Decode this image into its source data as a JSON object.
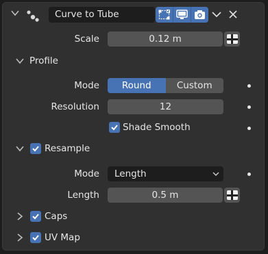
{
  "header": {
    "modifier_name": "Curve to Tube",
    "icons": [
      "modifier-node-icon",
      "edit-mode-toggle-icon",
      "viewport-display-icon",
      "render-camera-icon",
      "dropdown-chevron-icon",
      "close-icon"
    ]
  },
  "scale": {
    "label": "Scale",
    "value": "0.12 m"
  },
  "profile": {
    "title": "Profile",
    "expanded": true,
    "mode_label": "Mode",
    "mode_options": [
      "Round",
      "Custom"
    ],
    "mode_selected": "Round",
    "resolution_label": "Resolution",
    "resolution_value": "12",
    "shade_smooth_label": "Shade Smooth",
    "shade_smooth_checked": true
  },
  "resample": {
    "title": "Resample",
    "expanded": true,
    "checked": true,
    "mode_label": "Mode",
    "mode_value": "Length",
    "length_label": "Length",
    "length_value": "0.5 m"
  },
  "caps": {
    "title": "Caps",
    "expanded": false,
    "checked": true
  },
  "uvmap": {
    "title": "UV Map",
    "expanded": false,
    "checked": true
  },
  "colors": {
    "accent": "#4772b3",
    "panel": "#303030",
    "field": "#545454",
    "dark_field": "#1d1d1d"
  }
}
